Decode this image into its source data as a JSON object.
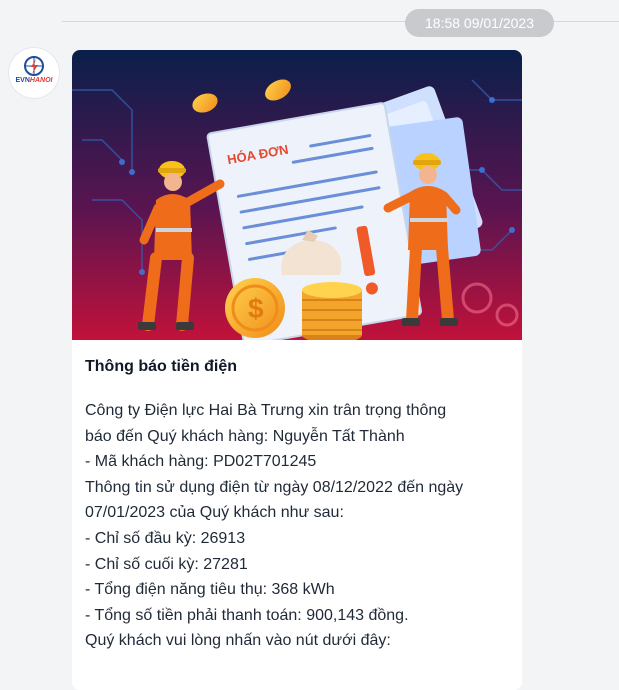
{
  "header": {
    "timestamp": "18:58 09/01/2023"
  },
  "sender": {
    "avatar_icon": "evn-hanoi-logo-icon",
    "logo_text_evn": "EVN",
    "logo_text_city": "HANOI"
  },
  "message": {
    "banner": {
      "invoice_label": "HÓA ĐƠN",
      "colors": {
        "background_top": "#0a1f4a",
        "background_bottom": "#c1123a",
        "worker_orange": "#ef6c1a",
        "helmet_yellow": "#f9c21a",
        "coin_gold": "#f7b22d"
      }
    },
    "title": "Thông báo tiền điện",
    "lines": [
      "Công ty Điện lực Hai Bà Trưng xin trân trọng thông",
      "báo đến Quý khách hàng: Nguyễn Tất Thành",
      "- Mã khách hàng: PD02T701245",
      "Thông tin sử dụng điện từ ngày 08/12/2022 đến ngày",
      "07/01/2023 của Quý khách như sau:",
      "- Chỉ số đầu kỳ: 26913",
      "- Chỉ số cuối kỳ: 27281",
      "- Tổng điện năng tiêu thụ: 368 kWh",
      "- Tổng số tiền phải thanh toán: 900,143 đồng.",
      "Quý khách vui lòng nhấn vào nút dưới đây:"
    ]
  }
}
